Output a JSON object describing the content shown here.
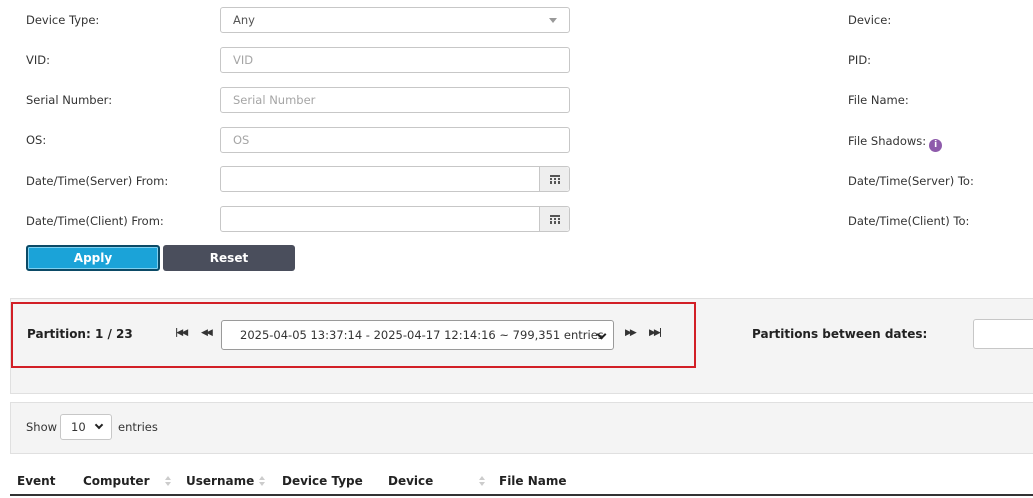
{
  "filters": {
    "device_type_label": "Device Type:",
    "device_type_value": "Any",
    "vid_label": "VID:",
    "vid_placeholder": "VID",
    "serial_label": "Serial Number:",
    "serial_placeholder": "Serial Number",
    "os_label": "OS:",
    "os_placeholder": "OS",
    "server_from_label": "Date/Time(Server) From:",
    "server_from_value": "",
    "client_from_label": "Date/Time(Client) From:",
    "client_from_value": "",
    "device_label": "Device:",
    "pid_label": "PID:",
    "file_name_label": "File Name:",
    "file_shadows_label": "File Shadows:",
    "server_to_label": "Date/Time(Server) To:",
    "client_to_label": "Date/Time(Client) To:",
    "calendar_icon": "calendar-icon",
    "info_icon": "info-icon",
    "info_glyph": "i"
  },
  "buttons": {
    "apply": "Apply",
    "reset": "Reset"
  },
  "partition": {
    "label": "Partition: 1 / 23",
    "current": 1,
    "total": 23,
    "selected": "2025-04-05 13:37:14 - 2025-04-17 12:14:16 ~ 799,351 entries",
    "between_label": "Partitions between dates:",
    "between_value": "",
    "highlight_color": "#d21f26"
  },
  "pager": {
    "show_label": "Show",
    "page_size": "10",
    "entries_label": "entries"
  },
  "table": {
    "columns": [
      "Event",
      "Computer",
      "Username",
      "Device Type",
      "Device",
      "File Name"
    ]
  },
  "colors": {
    "apply_bg": "#1ba3d8",
    "reset_bg": "#4a4e5c",
    "info_icon": "#8e5bab"
  }
}
